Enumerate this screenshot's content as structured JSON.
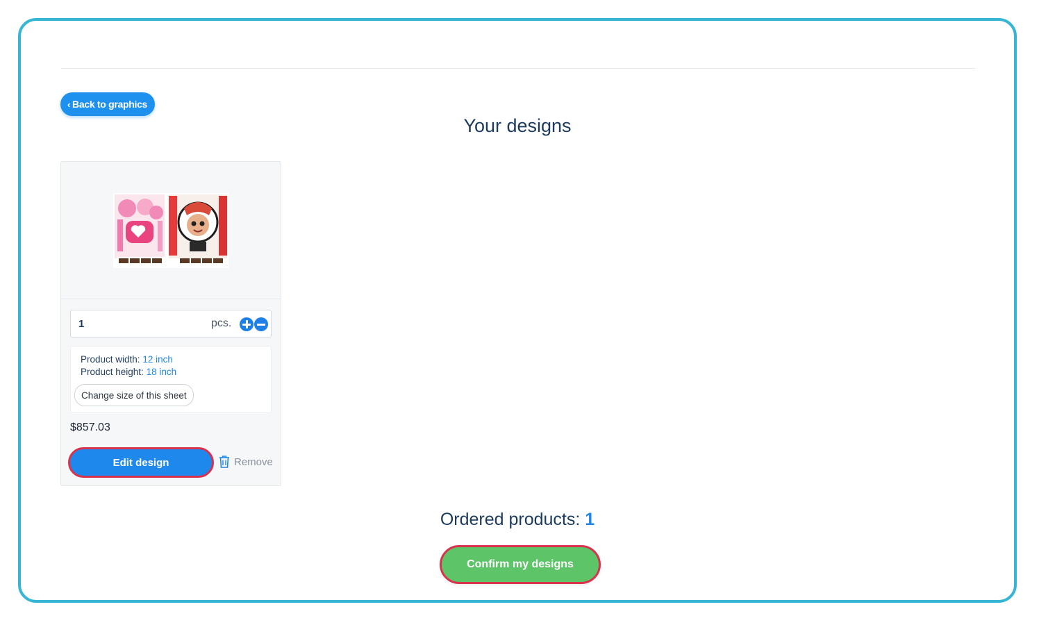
{
  "nav": {
    "back_label": "Back to graphics"
  },
  "page": {
    "title": "Your designs"
  },
  "design": {
    "quantity": "1",
    "unit": "pcs.",
    "width_label": "Product width:",
    "width_value": "12 inch",
    "height_label": "Product height:",
    "height_value": "18 inch",
    "change_size_label": "Change size of this sheet",
    "price": "$857.03",
    "edit_label": "Edit design",
    "remove_label": "Remove"
  },
  "summary": {
    "ordered_label": "Ordered products:",
    "ordered_count": "1",
    "confirm_label": "Confirm my designs"
  },
  "colors": {
    "frame_border": "#37b6d3",
    "primary_blue": "#1e88ec",
    "confirm_green": "#5dc468",
    "highlight_red": "#d8324d",
    "heading_navy": "#1d3b5c"
  }
}
